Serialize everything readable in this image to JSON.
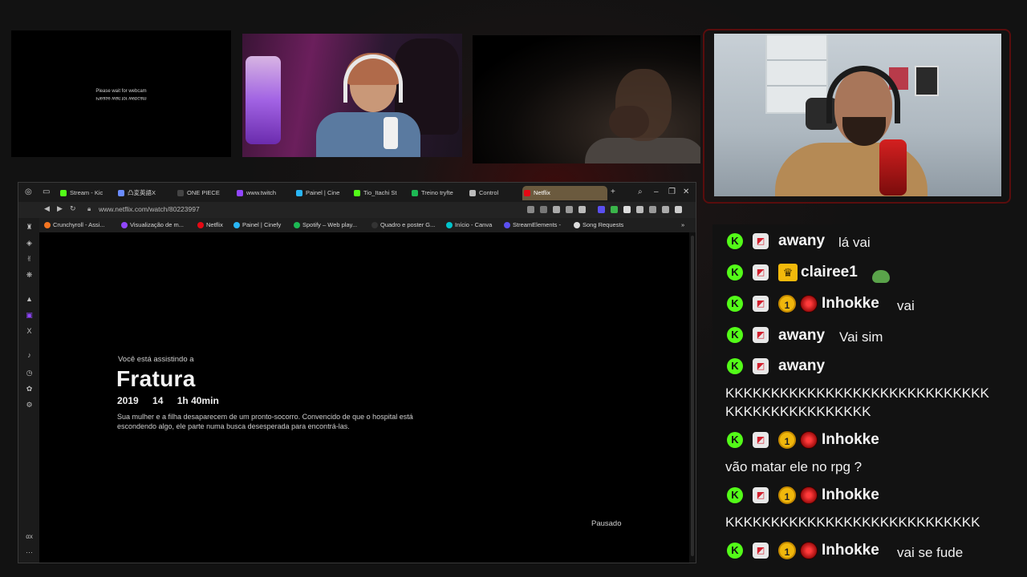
{
  "webcams": {
    "cam1_text": "Please wait for webcam",
    "cam1_text_mirror": "Please wait for webcam"
  },
  "browser": {
    "tabs": [
      {
        "label": "Stream - Kic",
        "color": "#53fc18"
      },
      {
        "label": "凸変英語X",
        "color": "#6a8cff"
      },
      {
        "label": "ONE PIECE",
        "color": "#444444"
      },
      {
        "label": "www.twitch",
        "color": "#9146ff"
      },
      {
        "label": "Painel | Cine",
        "color": "#29b6f6"
      },
      {
        "label": "Tio_Itachi St",
        "color": "#53fc18"
      },
      {
        "label": "Treino tryfte",
        "color": "#1db954"
      },
      {
        "label": "Control",
        "color": "#bbbbbb"
      },
      {
        "label": "Netflix",
        "color": "#e50914"
      }
    ],
    "new_tab": "+",
    "url": "www.netflix.com/watch/80223997",
    "bookmarks": [
      {
        "label": "Crunchyroll - Assi...",
        "color": "#f47521"
      },
      {
        "label": "Visualização de m...",
        "color": "#9146ff"
      },
      {
        "label": "Netflix",
        "color": "#e50914"
      },
      {
        "label": "Painel | Cinefy",
        "color": "#29b6f6"
      },
      {
        "label": "Spotify – Web play...",
        "color": "#1db954"
      },
      {
        "label": "Quadro e poster G...",
        "color": "#333333"
      },
      {
        "label": "Início - Canva",
        "color": "#00c4cc"
      },
      {
        "label": "StreamElements -",
        "color": "#5a4ff0"
      },
      {
        "label": "Song Requests",
        "color": "#dddddd"
      }
    ],
    "sidebar_bottom": "αx",
    "sidebar_more": "···"
  },
  "player": {
    "watching_label": "Você está assistindo a",
    "title": "Fratura",
    "year": "2019",
    "rating": "14",
    "duration": "1h 40min",
    "description": "Sua mulher e a filha desaparecem de um pronto-socorro. Convencido de que o hospital está escondendo algo, ele parte numa busca desesperada para encontrá-las.",
    "status": "Pausado"
  },
  "chat": {
    "messages": [
      {
        "user": "awany",
        "text": "lá vai"
      },
      {
        "user": "clairee1",
        "text": ""
      },
      {
        "user": "Inhokke",
        "text": "vai"
      },
      {
        "user": "awany",
        "text": "Vai sim"
      },
      {
        "user": "awany",
        "text": "KKKKKKKKKKKKKKKKKKKKKKKKKKKKK",
        "text2": "KKKKKKKKKKKKKKKK"
      },
      {
        "user": "Inhokke",
        "text": "vão matar ele no rpg ?"
      },
      {
        "user": "Inhokke",
        "text": "KKKKKKKKKKKKKKKKKKKKKKKKKKKK"
      },
      {
        "user": "Inhokke",
        "text": "vai se fude"
      }
    ],
    "badge_k": "K",
    "badge_sub": "1"
  },
  "colors": {
    "kick_green": "#53fc18",
    "accent_red": "#d42020",
    "gold": "#f0b70c"
  }
}
